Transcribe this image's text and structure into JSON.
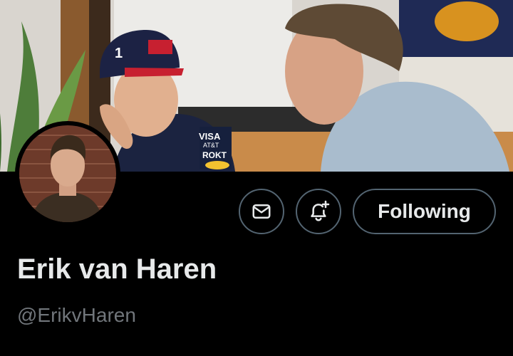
{
  "profile": {
    "display_name": "Erik van Haren",
    "handle": "@ErikvHaren",
    "banner_image": "banner-photo",
    "avatar_image": "avatar-photo"
  },
  "actions": {
    "message_icon": "envelope-icon",
    "notify_icon": "bell-plus-icon",
    "follow_label": "Following"
  },
  "colors": {
    "background": "#000000",
    "text_primary": "#e7e9ea",
    "text_secondary": "#71767b",
    "button_border": "#536471"
  }
}
